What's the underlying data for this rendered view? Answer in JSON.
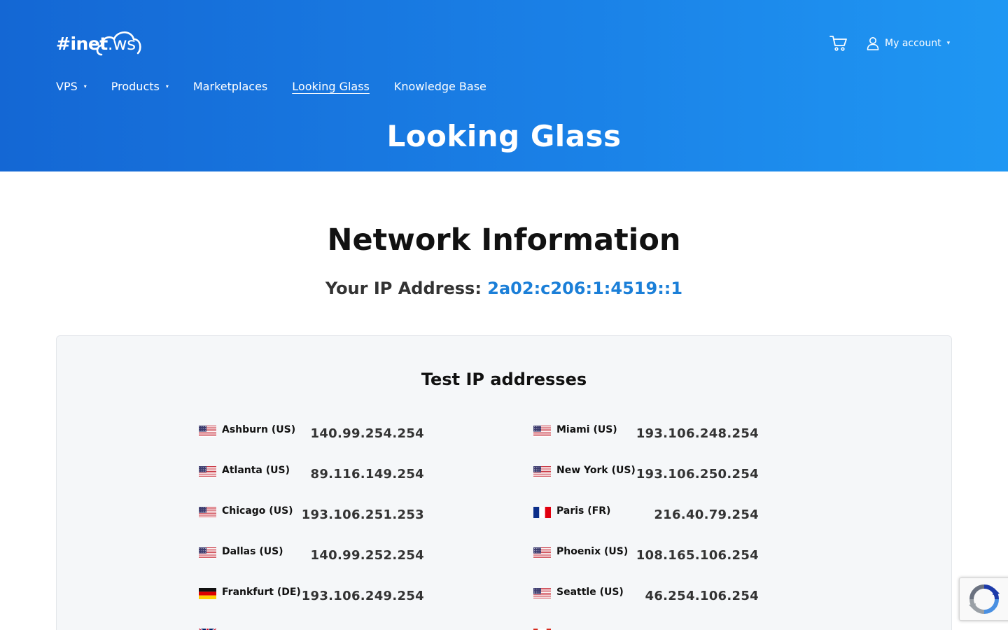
{
  "header": {
    "logo_text_bold": "#inet",
    "logo_text_rest": ".ws",
    "account_label": "My account",
    "nav": [
      {
        "label": "VPS",
        "has_dropdown": true
      },
      {
        "label": "Products",
        "has_dropdown": true
      },
      {
        "label": "Marketplaces",
        "has_dropdown": false
      },
      {
        "label": "Looking Glass",
        "has_dropdown": false,
        "active": true
      },
      {
        "label": "Knowledge Base",
        "has_dropdown": false
      }
    ],
    "page_title": "Looking Glass"
  },
  "main": {
    "section_title": "Network Information",
    "ip_label": "Your IP Address: ",
    "ip_value": "2a02:c206:1:4519::1"
  },
  "test_panel": {
    "title": "Test IP addresses",
    "left_column": [
      {
        "name": "Ashburn (US)",
        "ip": "140.99.254.254",
        "flag": "us-flag-icon"
      },
      {
        "name": "Atlanta (US)",
        "ip": "89.116.149.254",
        "flag": "us-flag-icon"
      },
      {
        "name": "Chicago (US)",
        "ip": "193.106.251.253",
        "flag": "us-flag-icon"
      },
      {
        "name": "Dallas (US)",
        "ip": "140.99.252.254",
        "flag": "us-flag-icon"
      },
      {
        "name": "Frankfurt (DE)",
        "ip": "193.106.249.254",
        "flag": "de-flag-icon"
      },
      {
        "name": "",
        "ip": "",
        "flag": "uk-flag-icon"
      }
    ],
    "right_column": [
      {
        "name": "Miami (US)",
        "ip": "193.106.248.254",
        "flag": "us-flag-icon"
      },
      {
        "name": "New York (US)",
        "ip": "193.106.250.254",
        "flag": "us-flag-icon"
      },
      {
        "name": "Paris (FR)",
        "ip": "216.40.79.254",
        "flag": "fr-flag-icon"
      },
      {
        "name": "Phoenix (US)",
        "ip": "108.165.106.254",
        "flag": "us-flag-icon"
      },
      {
        "name": "Seattle (US)",
        "ip": "46.254.106.254",
        "flag": "us-flag-icon"
      },
      {
        "name": "",
        "ip": "",
        "flag": "ca-flag-icon"
      }
    ]
  },
  "colors": {
    "hero_start": "#1467d4",
    "hero_end": "#1f97f3",
    "ip_accent": "#1b7fd8",
    "panel_bg": "#f5f7f9"
  },
  "icons": {
    "cart": "cart-icon",
    "user": "user-icon",
    "caret": "chevron-down-icon",
    "recaptcha": "recaptcha-icon"
  }
}
